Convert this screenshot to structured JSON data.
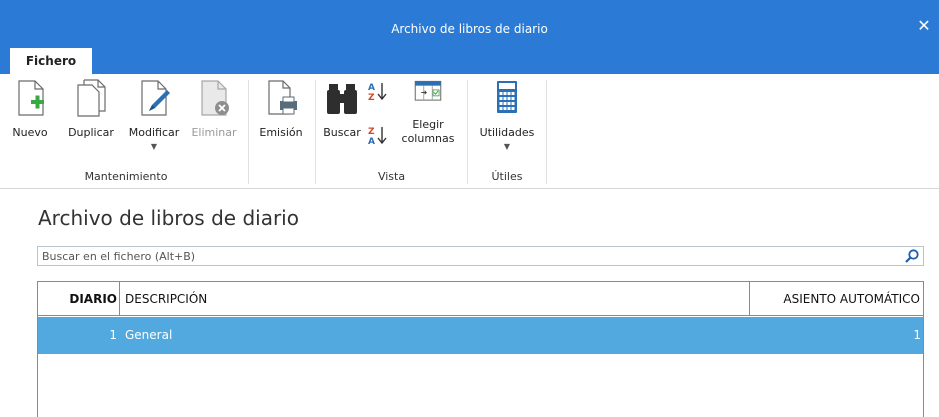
{
  "window": {
    "title": "Archivo de libros de diario",
    "close_glyph": "✕"
  },
  "tabs": [
    {
      "label": "Fichero",
      "active": true
    }
  ],
  "ribbon": {
    "groups": [
      {
        "label": "Mantenimiento"
      },
      {
        "label": "Vista"
      },
      {
        "label": "Útiles"
      }
    ],
    "buttons": {
      "nuevo": {
        "label": "Nuevo",
        "icon": "new-document-icon"
      },
      "duplicar": {
        "label": "Duplicar",
        "icon": "duplicate-icon"
      },
      "modificar": {
        "label": "Modificar",
        "icon": "edit-document-icon",
        "has_dropdown": true
      },
      "eliminar": {
        "label": "Eliminar",
        "icon": "delete-document-icon",
        "disabled": true
      },
      "emision": {
        "label": "Emisión",
        "icon": "print-icon"
      },
      "buscar": {
        "label": "Buscar",
        "icon": "binoculars-icon"
      },
      "sort_asc": {
        "label": "A↓Z",
        "icon": "sort-ascending-icon"
      },
      "sort_desc": {
        "label": "Z↓A",
        "icon": "sort-descending-icon"
      },
      "elegir_columnas": {
        "label_line1": "Elegir",
        "label_line2": "columnas",
        "icon": "choose-columns-icon"
      },
      "utilidades": {
        "label": "Utilidades",
        "icon": "calculator-icon",
        "has_dropdown": true
      }
    }
  },
  "main": {
    "page_title": "Archivo de libros de diario",
    "search": {
      "placeholder": "Buscar en el fichero (Alt+B)",
      "value": ""
    },
    "table": {
      "columns": [
        "DIARIO",
        "DESCRIPCIÓN",
        "ASIENTO AUTOMÁTICO"
      ],
      "rows": [
        {
          "diario": "1",
          "descripcion": "General",
          "asiento_automatico": "1",
          "selected": true
        }
      ]
    }
  },
  "colors": {
    "titlebar": "#2b7bd6",
    "selected_row": "#52a9e0",
    "icon_accent_green": "#3aa844",
    "icon_accent_blue": "#2b6fb5"
  }
}
